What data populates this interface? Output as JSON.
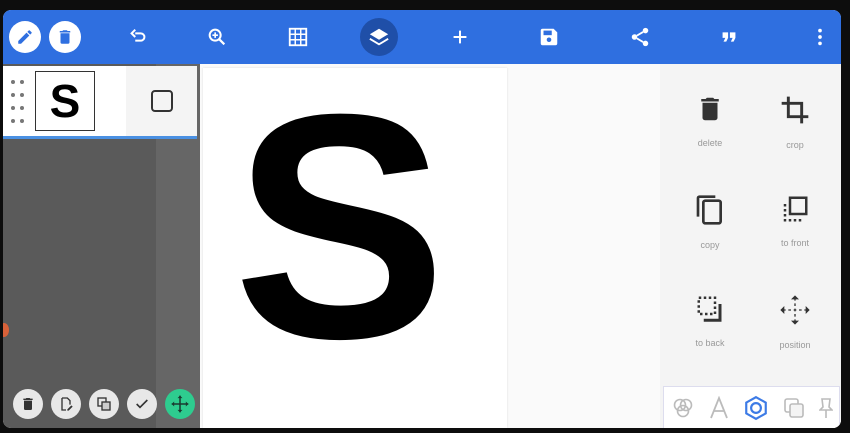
{
  "toolbar": {
    "left_buttons": [
      "pencil-icon",
      "trash-icon"
    ],
    "icons": [
      "undo-icon",
      "zoom-icon",
      "grid-icon",
      "layers-icon",
      "add-icon",
      "save-icon",
      "share-icon",
      "quote-icon",
      "more-icon"
    ],
    "active": "layers-icon",
    "accent": "#2f6fe0"
  },
  "layers": {
    "items": [
      {
        "thumb_text": "S",
        "selected": true
      }
    ],
    "bottom_buttons": [
      "trash-icon",
      "edit-layer-icon",
      "merge-icon",
      "check-icon",
      "move-icon"
    ],
    "active_bottom": "move-icon"
  },
  "canvas": {
    "text": "S"
  },
  "actions": [
    {
      "icon": "delete-icon",
      "label": "delete"
    },
    {
      "icon": "crop-icon",
      "label": "crop"
    },
    {
      "icon": "copy-icon",
      "label": "copy"
    },
    {
      "icon": "to-front-icon",
      "label": "to front"
    },
    {
      "icon": "to-back-icon",
      "label": "to back"
    },
    {
      "icon": "position-icon",
      "label": "position"
    }
  ],
  "bottom_tabs": [
    "blend-icon",
    "text-icon",
    "shape-icon",
    "duplicate-icon",
    "pin-icon"
  ]
}
